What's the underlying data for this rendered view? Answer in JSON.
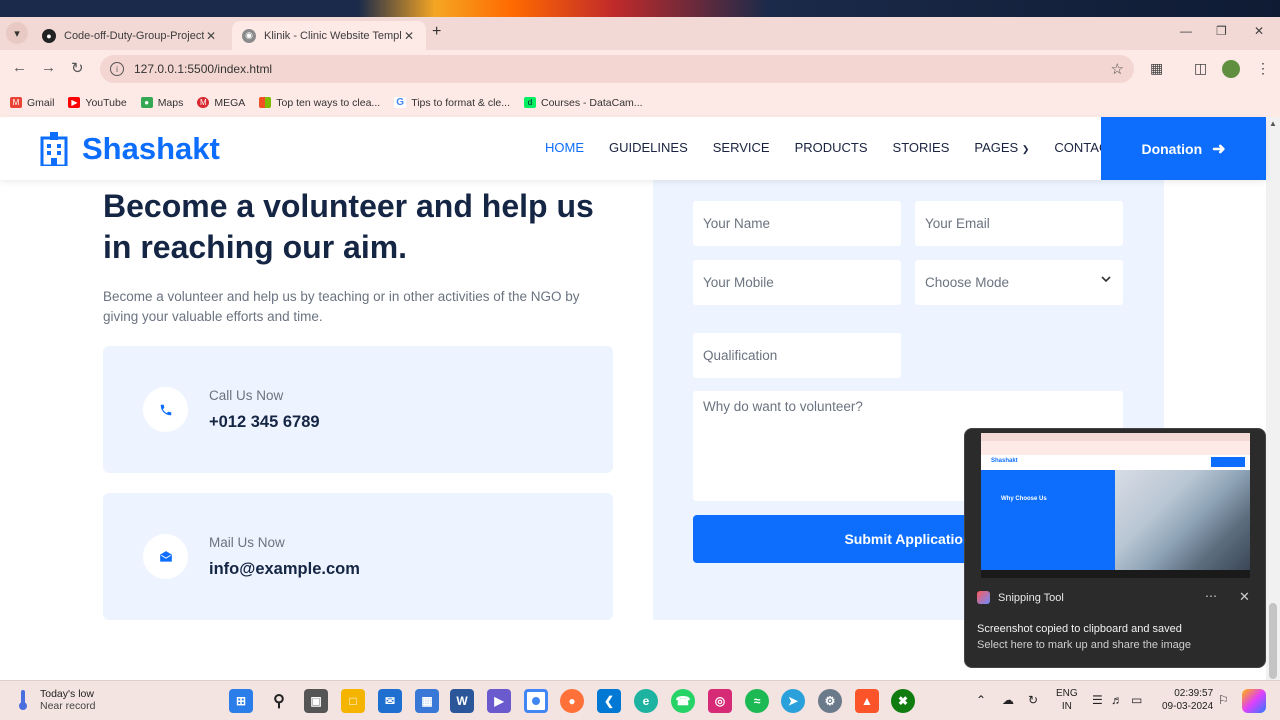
{
  "browser": {
    "tabs": [
      {
        "title": "Code-off-Duty-Group-Project/F",
        "icon": "github-icon",
        "active": false
      },
      {
        "title": "Klinik - Clinic Website Template",
        "icon": "globe-icon",
        "active": true
      }
    ],
    "url": "127.0.0.1:5500/index.html",
    "bookmarks": [
      {
        "label": "Gmail",
        "color": "#ea4335"
      },
      {
        "label": "YouTube",
        "color": "#ff0000"
      },
      {
        "label": "Maps",
        "color": "#34a853"
      },
      {
        "label": "MEGA",
        "color": "#d9272e"
      },
      {
        "label": "Top ten ways to clea...",
        "color": "#f4b400"
      },
      {
        "label": "Tips to format & cle...",
        "color": "#4285f4"
      },
      {
        "label": "Courses - DataCam...",
        "color": "#03ef62"
      }
    ]
  },
  "site": {
    "brand": "Shashakt",
    "nav": [
      {
        "label": "HOME",
        "active": true
      },
      {
        "label": "GUIDELINES",
        "active": false
      },
      {
        "label": "SERVICE",
        "active": false
      },
      {
        "label": "PRODUCTS",
        "active": false
      },
      {
        "label": "STORIES",
        "active": false
      },
      {
        "label": "PAGES",
        "active": false,
        "dropdown": true
      },
      {
        "label": "CONTACT",
        "active": false
      }
    ],
    "donate_label": "Donation",
    "accent": "#0d6efd"
  },
  "volunteer": {
    "heading": "Become a volunteer and help us in reaching our aim.",
    "description": "Become a volunteer and help us by teaching or in other activities of the NGO by giving your valuable efforts and time.",
    "call_label": "Call Us Now",
    "call_value": "+012 345 6789",
    "mail_label": "Mail Us Now",
    "mail_value": "info@example.com"
  },
  "form": {
    "name_placeholder": "Your Name",
    "email_placeholder": "Your Email",
    "mobile_placeholder": "Your Mobile",
    "mode_selected": "Choose Mode",
    "qualification_placeholder": "Qualification",
    "why_placeholder": "Why do want to volunteer?",
    "submit_label": "Submit Application"
  },
  "notification": {
    "app": "Snipping Tool",
    "line1": "Screenshot copied to clipboard and saved",
    "line2": "Select here to mark up and share the image",
    "thumb_brand": "Shashakt",
    "thumb_heading": "Why Choose Us"
  },
  "taskbar": {
    "weather_title": "Today's low",
    "weather_sub": "Near record",
    "lang1": "ENG",
    "lang2": "IN",
    "time": "02:39:57",
    "date": "09-03-2024"
  }
}
